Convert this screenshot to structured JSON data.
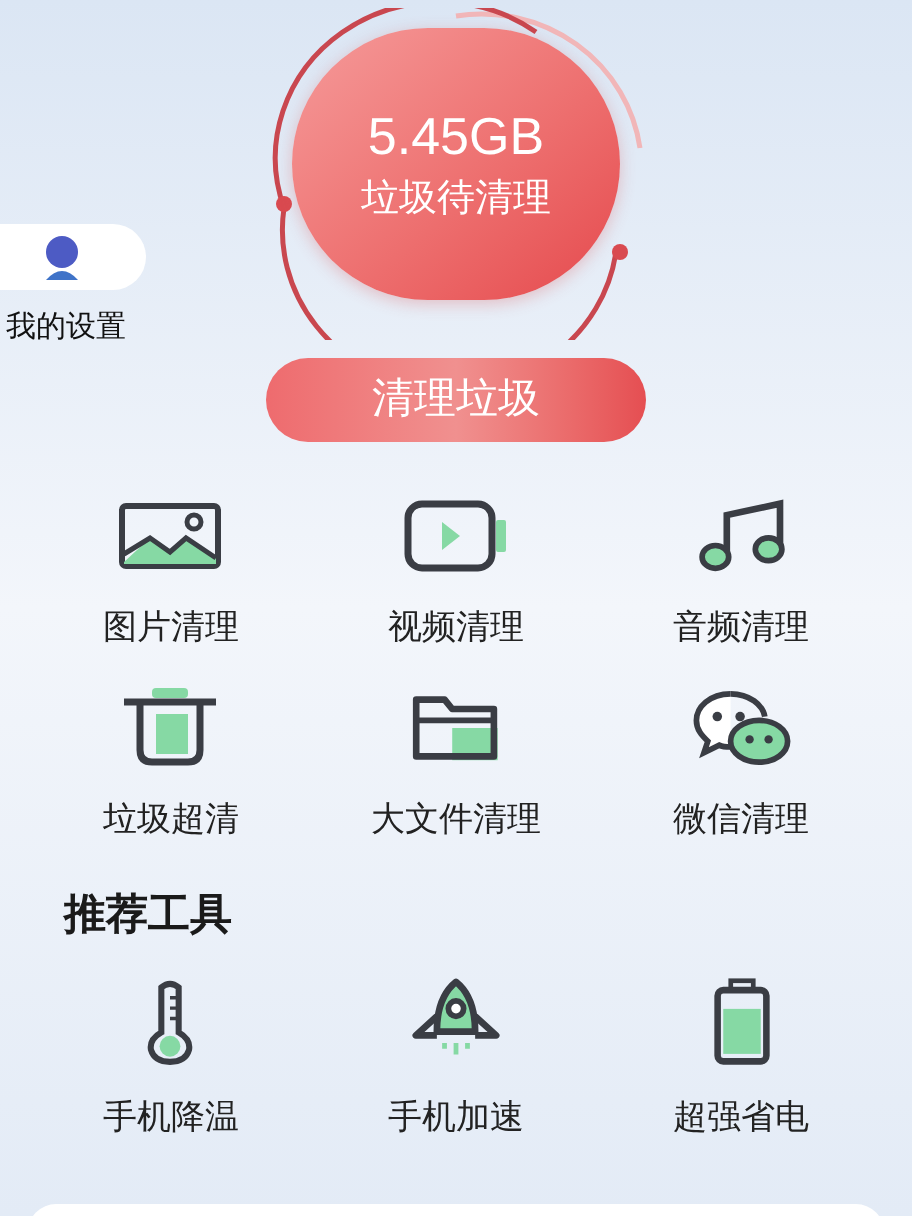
{
  "junk": {
    "size": "5.45GB",
    "caption": "垃圾待清理"
  },
  "settings": {
    "label": "我的设置"
  },
  "clean_button": {
    "label": "清理垃圾"
  },
  "features": [
    {
      "label": "图片清理"
    },
    {
      "label": "视频清理"
    },
    {
      "label": "音频清理"
    },
    {
      "label": "垃圾超清"
    },
    {
      "label": "大文件清理"
    },
    {
      "label": "微信清理"
    }
  ],
  "tools_section": {
    "title": "推荐工具",
    "items": [
      {
        "label": "手机降温"
      },
      {
        "label": "手机加速"
      },
      {
        "label": "超强省电"
      }
    ]
  }
}
